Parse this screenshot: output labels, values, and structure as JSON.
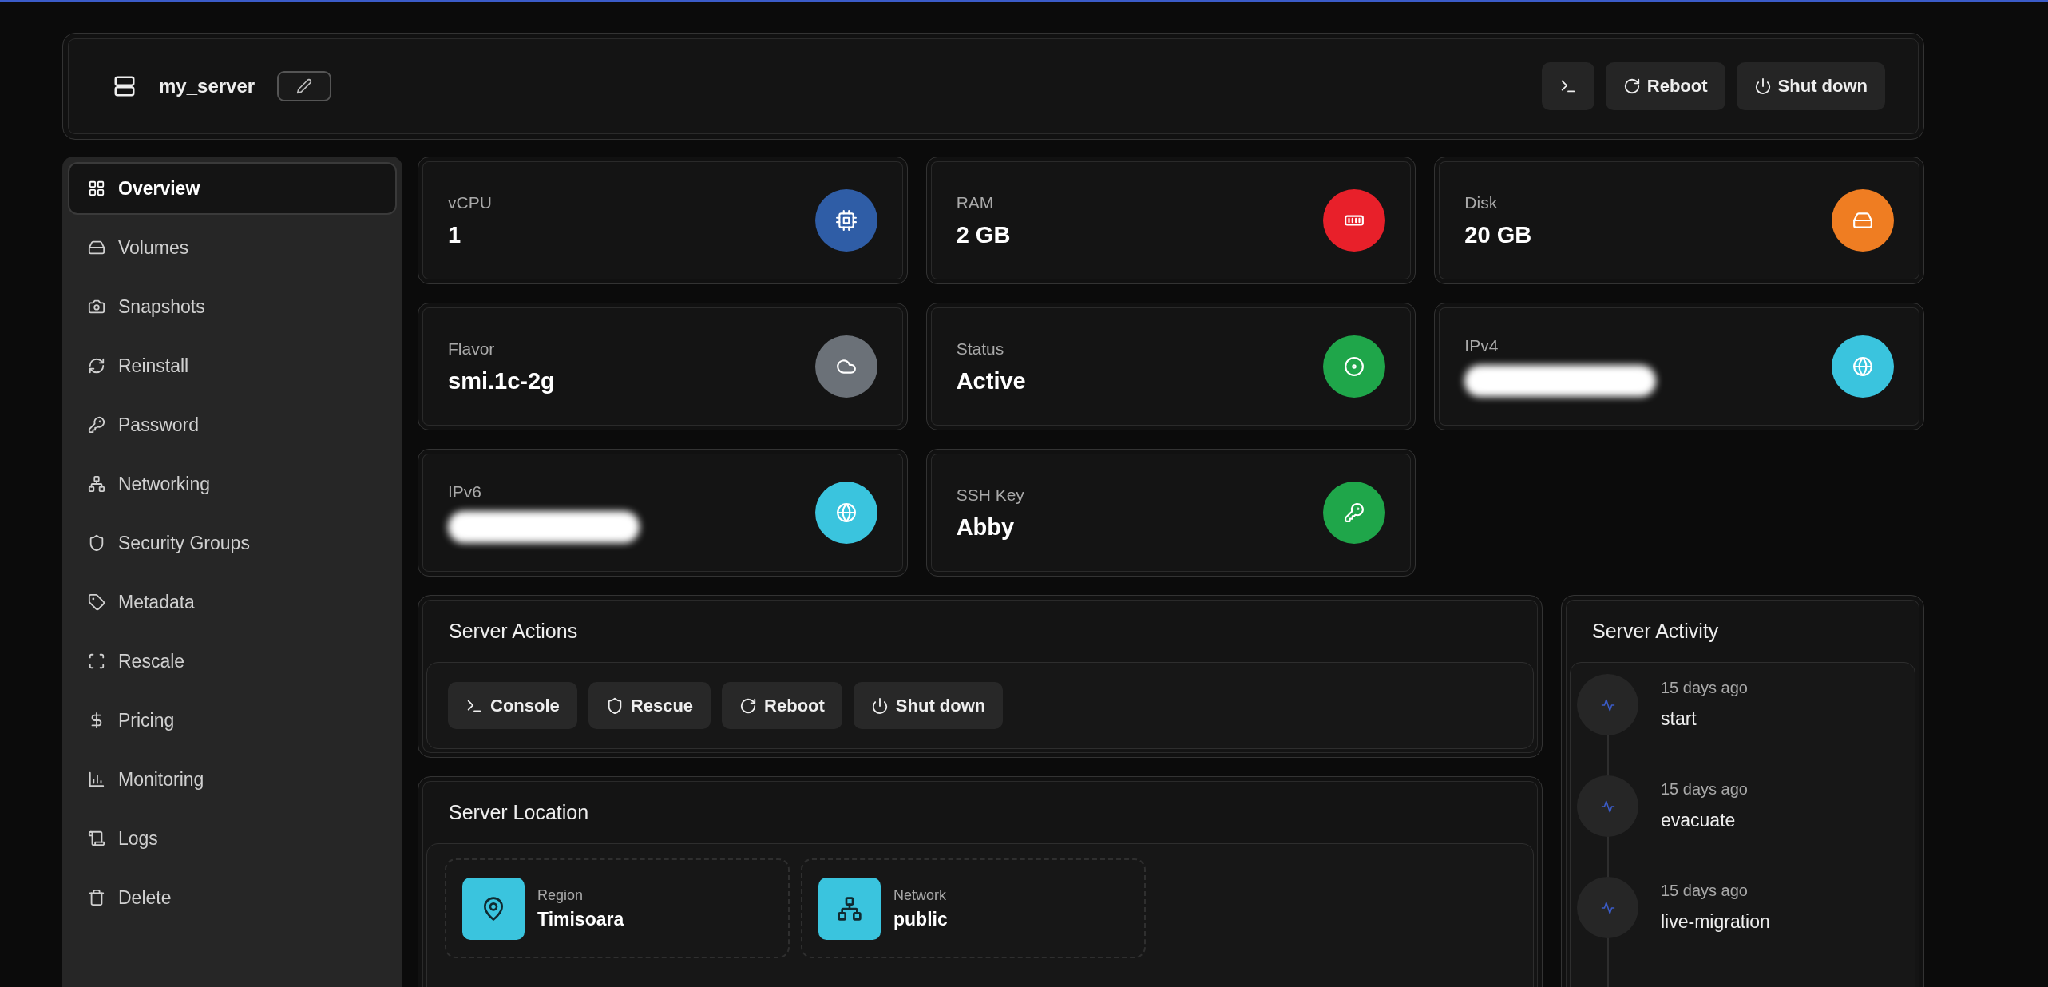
{
  "header": {
    "title": "my_server",
    "actions": [
      {
        "kind": "console"
      },
      {
        "kind": "reboot",
        "label": "Reboot"
      },
      {
        "kind": "shutdown",
        "label": "Shut down"
      }
    ]
  },
  "sidebar": {
    "items": [
      {
        "label": "Overview",
        "kind": "overview",
        "selected": true
      },
      {
        "label": "Volumes",
        "kind": "volumes",
        "selected": false
      },
      {
        "label": "Snapshots",
        "kind": "snapshots",
        "selected": false
      },
      {
        "label": "Reinstall",
        "kind": "reinstall",
        "selected": false
      },
      {
        "label": "Password",
        "kind": "password",
        "selected": false
      },
      {
        "label": "Networking",
        "kind": "networking",
        "selected": false
      },
      {
        "label": "Security Groups",
        "kind": "security",
        "selected": false
      },
      {
        "label": "Metadata",
        "kind": "metadata",
        "selected": false
      },
      {
        "label": "Rescale",
        "kind": "rescale",
        "selected": false
      },
      {
        "label": "Pricing",
        "kind": "pricing",
        "selected": false
      },
      {
        "label": "Monitoring",
        "kind": "monitoring",
        "selected": false
      },
      {
        "label": "Logs",
        "kind": "logs",
        "selected": false
      },
      {
        "label": "Delete",
        "kind": "delete",
        "selected": false
      }
    ]
  },
  "stats": [
    {
      "label": "vCPU",
      "value": "1",
      "kind": "cpu",
      "color": "#2f5da6"
    },
    {
      "label": "RAM",
      "value": "2 GB",
      "kind": "memory",
      "color": "#e8202a"
    },
    {
      "label": "Disk",
      "value": "20 GB",
      "kind": "disk",
      "color": "#ef7d22"
    },
    {
      "label": "Flavor",
      "value": "smi.1c-2g",
      "kind": "cloud",
      "color": "#6b7178"
    },
    {
      "label": "Status",
      "value": "Active",
      "kind": "status",
      "color": "#1fa64a"
    },
    {
      "label": "IPv4",
      "redacted": true,
      "kind": "globe",
      "color": "#3ac4de"
    },
    {
      "label": "IPv6",
      "redacted": true,
      "kind": "globe",
      "color": "#3ac4de"
    },
    {
      "label": "SSH Key",
      "value": "Abby",
      "kind": "key",
      "color": "#1fa64a"
    }
  ],
  "server_actions": {
    "title": "Server Actions",
    "buttons": [
      {
        "label": "Console",
        "kind": "console"
      },
      {
        "label": "Rescue",
        "kind": "rescue"
      },
      {
        "label": "Reboot",
        "kind": "reboot"
      },
      {
        "label": "Shut down",
        "kind": "shutdown"
      }
    ]
  },
  "server_location": {
    "title": "Server Location",
    "items": [
      {
        "label": "Region",
        "value": "Timisoara",
        "kind": "pin"
      },
      {
        "label": "Network",
        "value": "public",
        "kind": "network"
      }
    ]
  },
  "server_activity": {
    "title": "Server Activity",
    "items": [
      {
        "time": "15 days ago",
        "event": "start"
      },
      {
        "time": "15 days ago",
        "event": "evacuate"
      },
      {
        "time": "15 days ago",
        "event": "live-migration"
      }
    ]
  }
}
